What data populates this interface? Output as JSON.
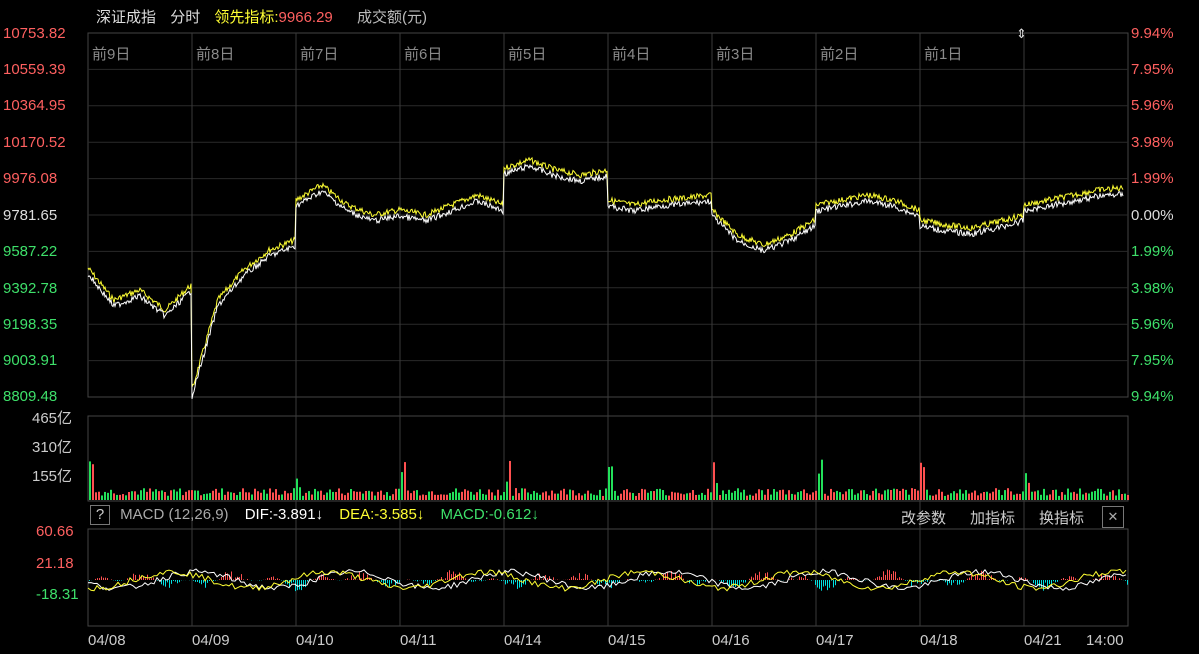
{
  "header": {
    "index_name": "深证成指",
    "mode": "分时",
    "leader_label": "领先指标:",
    "leader_value": "9966.29",
    "turnover_label": "成交额(元)"
  },
  "price_axis": [
    "10753.82",
    "10559.39",
    "10364.95",
    "10170.52",
    "9976.08",
    "9781.65",
    "9587.22",
    "9392.78",
    "9198.35",
    "9003.91",
    "8809.48"
  ],
  "pct_axis": [
    "9.94%",
    "7.95%",
    "5.96%",
    "3.98%",
    "1.99%",
    "0.00%",
    "1.99%",
    "3.98%",
    "5.96%",
    "7.95%",
    "9.94%"
  ],
  "day_labels": [
    "前9日",
    "前8日",
    "前7日",
    "前6日",
    "前5日",
    "前4日",
    "前3日",
    "前2日",
    "前1日"
  ],
  "volume_axis": [
    "465亿",
    "310亿",
    "155亿"
  ],
  "macd": {
    "help": "?",
    "title": "MACD (12,26,9)",
    "dif": "DIF:-3.891↓",
    "dea": "DEA:-3.585↓",
    "macd": "MACD:-0.612↓",
    "btn_params": "改参数",
    "btn_add": "加指标",
    "btn_switch": "换指标",
    "btn_close": "✕",
    "axis": [
      "60.66",
      "21.18",
      "-18.31"
    ]
  },
  "date_axis": [
    "04/08",
    "04/09",
    "04/10",
    "04/11",
    "04/14",
    "04/15",
    "04/16",
    "04/17",
    "04/18",
    "04/21",
    "14:00"
  ],
  "colors": {
    "up": "#ff5050",
    "down": "#22e05a",
    "yellow": "#ffff33",
    "white": "#ffffff",
    "cyan": "#00e0e0",
    "grid": "#2a2a2a",
    "frame": "#444"
  }
}
